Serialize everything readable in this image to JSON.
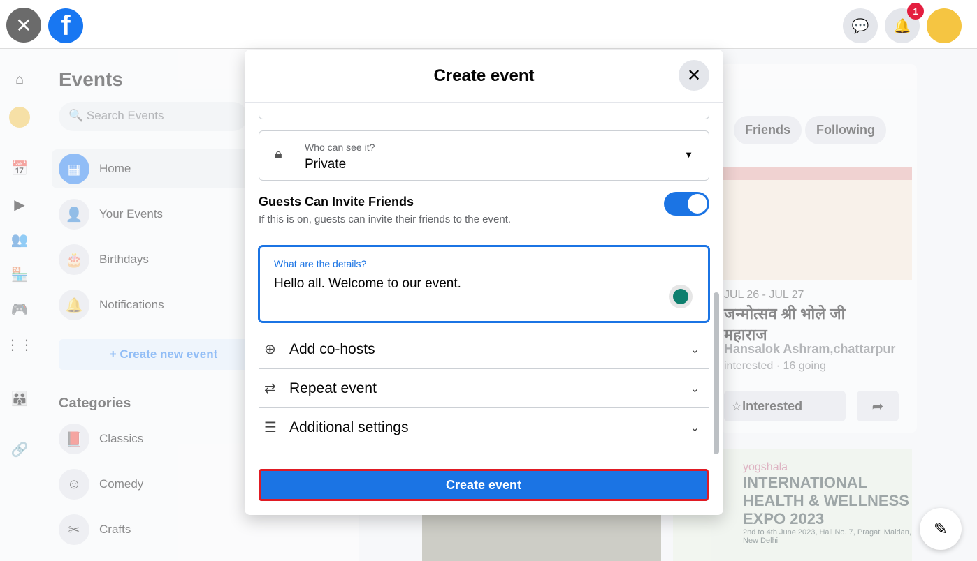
{
  "topbar": {
    "notification_count": "1"
  },
  "sidebar": {
    "title": "Events",
    "search_placeholder": "Search Events",
    "items": [
      {
        "label": "Home"
      },
      {
        "label": "Your Events"
      },
      {
        "label": "Birthdays"
      },
      {
        "label": "Notifications"
      }
    ],
    "create_new": "+ Create new event",
    "categories_title": "Categories",
    "categories": [
      {
        "label": "Classics"
      },
      {
        "label": "Comedy"
      },
      {
        "label": "Crafts"
      }
    ]
  },
  "main": {
    "tabs": [
      "Friends",
      "Following"
    ],
    "event": {
      "date": "JUL 26 - JUL 27",
      "title": "जन्मोत्सव श्री भोले जी महाराज",
      "location": "Hansalok Ashram,chattarpur",
      "stats": "interested · 16 going",
      "interested_label": "Interested"
    },
    "event2": {
      "brand": "yogshala",
      "title": "INTERNATIONAL HEALTH & WELLNESS EXPO 2023",
      "dates": "2nd to 4th June 2023, Hall No. 7, Pragati Maidan, New Delhi"
    }
  },
  "modal": {
    "title": "Create event",
    "privacy": {
      "label": "Who can see it?",
      "value": "Private"
    },
    "guests": {
      "title": "Guests Can Invite Friends",
      "desc": "If this is on, guests can invite their friends to the event.",
      "on": true
    },
    "details": {
      "label": "What are the details?",
      "value": "Hello all. Welcome to our event."
    },
    "rows": [
      {
        "label": "Add co-hosts",
        "icon": "plus-circle-icon"
      },
      {
        "label": "Repeat event",
        "icon": "repeat-icon"
      },
      {
        "label": "Additional settings",
        "icon": "list-icon"
      }
    ],
    "submit": "Create event"
  },
  "colors": {
    "accent": "#1b74e4",
    "highlight_border": "#e01b24"
  }
}
